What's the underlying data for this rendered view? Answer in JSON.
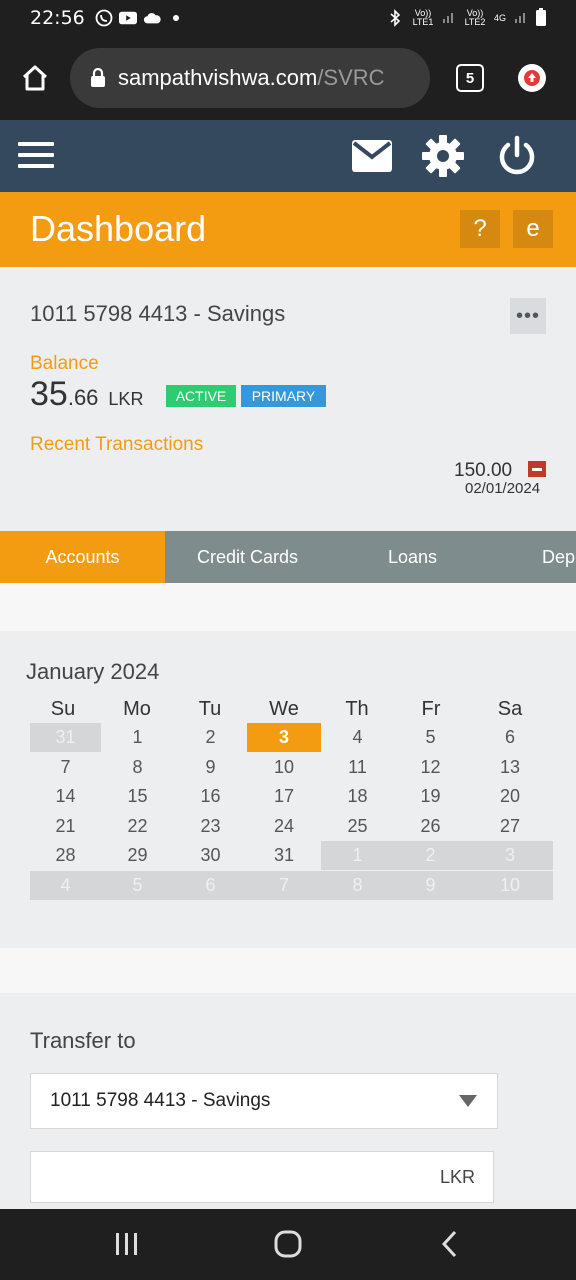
{
  "status": {
    "time": "22:56",
    "sim1_label": "Vo)) LTE1",
    "sim2_label": "Vo)) LTE2",
    "network": "4G"
  },
  "browser": {
    "url_main": "sampathvishwa.com",
    "url_path": "/SVRC",
    "tab_count": "5"
  },
  "page": {
    "title": "Dashboard",
    "help_label": "?",
    "e_label": "e"
  },
  "account": {
    "name": "1011 5798 4413 - Savings",
    "more_label": "•••",
    "balance_label": "Balance",
    "balance_whole": "35",
    "balance_decimal": ".66",
    "currency": "LKR",
    "status_badge": "ACTIVE",
    "primary_badge": "PRIMARY",
    "status_color": "#2ecc71",
    "primary_color": "#3498db",
    "recent_label": "Recent Transactions",
    "transaction": {
      "amount": "150.00",
      "date": "02/01/2024",
      "type": "debit"
    }
  },
  "product_tabs": [
    "Accounts",
    "Credit Cards",
    "Loans",
    "Dep"
  ],
  "calendar": {
    "title": "January 2024",
    "weekdays": [
      "Su",
      "Mo",
      "Tu",
      "We",
      "Th",
      "Fr",
      "Sa"
    ],
    "weeks": [
      [
        "31",
        "1",
        "2",
        "3",
        "4",
        "5",
        "6"
      ],
      [
        "7",
        "8",
        "9",
        "10",
        "11",
        "12",
        "13"
      ],
      [
        "14",
        "15",
        "16",
        "17",
        "18",
        "19",
        "20"
      ],
      [
        "21",
        "22",
        "23",
        "24",
        "25",
        "26",
        "27"
      ],
      [
        "28",
        "29",
        "30",
        "31",
        "1",
        "2",
        "3"
      ],
      [
        "4",
        "5",
        "6",
        "7",
        "8",
        "9",
        "10"
      ]
    ],
    "selected_day": "3"
  },
  "transfer": {
    "label": "Transfer to",
    "selected_account": "1011 5798 4413 - Savings",
    "amount_value": "",
    "amount_currency": "LKR"
  },
  "colors": {
    "accent": "#f39c12",
    "header": "#34495e",
    "tabs_bg": "#7f8c8d",
    "debit": "#c0392b"
  }
}
